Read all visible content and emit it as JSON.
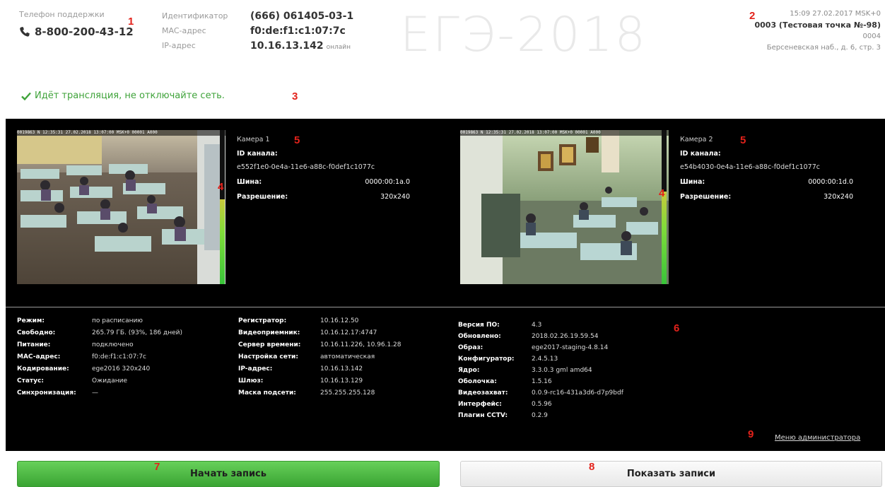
{
  "header": {
    "support_label": "Телефон поддержки",
    "support_phone": "8-800-200-43-12",
    "ids": [
      {
        "label": "Идентификатор",
        "value": "(666) 061405-03-1"
      },
      {
        "label": "MAC-адрес",
        "value": "f0:de:f1:c1:07:7c"
      },
      {
        "label": "IP-адрес",
        "value": "10.16.13.142",
        "sub": "онлайн"
      }
    ],
    "watermark": "ЕГЭ-2018",
    "datetime": "15:09 27.02.2017 MSK+0",
    "point": "0003 (Тестовая точка №-98)",
    "code": "0004",
    "address": "Берсеневская наб., д. 6, стр. 3"
  },
  "status": {
    "text": "Идёт трансляция, не отключайте сеть."
  },
  "markers": {
    "m1": "1",
    "m2": "2",
    "m3": "3",
    "m4": "4",
    "m5": "5",
    "m6": "6",
    "m7": "7",
    "m8": "8",
    "m9": "9"
  },
  "cameras": [
    {
      "name": "Камера 1",
      "channel_label": "ID канала:",
      "channel_id": "e552f1e0-0e4a-11e6-a88c-f0def1c1077c",
      "bus_label": "Шина:",
      "bus": "0000:00:1a.0",
      "resolution_label": "Разрешение:",
      "resolution": "320x240",
      "osd": "0019863 N 12:35:31 27.02.2018 13:07:00 MSK+0 00001 A000",
      "audio_level": 0.55
    },
    {
      "name": "Камера 2",
      "channel_label": "ID канала:",
      "channel_id": "e54b4030-0e4a-11e6-a88c-f0def1c1077c",
      "bus_label": "Шина:",
      "bus": "0000:00:1d.0",
      "resolution_label": "Разрешение:",
      "resolution": "320x240",
      "osd": "0019863 N 12:35:31 27.02.2018 13:07:00 MSK+0 00001 A000",
      "audio_level": 0.6
    }
  ],
  "info_left": [
    {
      "k": "Режим:",
      "v": "по расписанию"
    },
    {
      "k": "Свободно:",
      "v": "265.79 ГБ. (93%, 186 дней)"
    },
    {
      "k": "Питание:",
      "v": "подключено"
    },
    {
      "k": "MAC-адрес:",
      "v": "f0:de:f1:c1:07:7c"
    },
    {
      "k": "Кодирование:",
      "v": "ege2016 320x240"
    },
    {
      "k": "Статус:",
      "v": "Ожидание"
    },
    {
      "k": "Синхронизация:",
      "v": "—"
    }
  ],
  "info_mid": [
    {
      "k": "Регистратор:",
      "v": "10.16.12.50"
    },
    {
      "k": "Видеоприемник:",
      "v": "10.16.12.17:4747"
    },
    {
      "k": "Сервер времени:",
      "v": "10.16.11.226, 10.96.1.28"
    },
    {
      "k": "Настройка сети:",
      "v": "автоматическая"
    },
    {
      "k": "IP-адрес:",
      "v": "10.16.13.142"
    },
    {
      "k": "Шлюз:",
      "v": "10.16.13.129"
    },
    {
      "k": "Маска подсети:",
      "v": "255.255.255.128"
    }
  ],
  "info_right": [
    {
      "k": "Версия ПО:",
      "v": "4.3"
    },
    {
      "k": "Обновлено:",
      "v": "2018.02.26.19.59.54"
    },
    {
      "k": "Образ:",
      "v": "ege2017-staging-4.8.14"
    },
    {
      "k": "Конфигуратор:",
      "v": "2.4.5.13"
    },
    {
      "k": "Ядро:",
      "v": "3.3.0.3 gml amd64"
    },
    {
      "k": "Оболочка:",
      "v": "1.5.16"
    },
    {
      "k": "Видеозахват:",
      "v": "0.0.9-rc16-431a3d6-d7p9bdf"
    },
    {
      "k": "Интерфейс:",
      "v": "0.5.96"
    },
    {
      "k": "Плагин CCTV:",
      "v": "0.2.9"
    }
  ],
  "admin_link": "Меню администратора",
  "buttons": {
    "start": "Начать запись",
    "show": "Показать записи"
  }
}
